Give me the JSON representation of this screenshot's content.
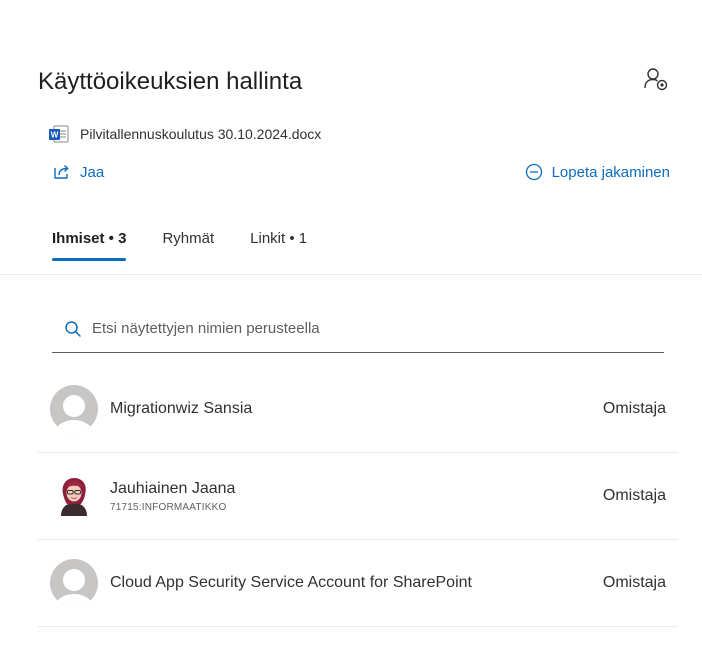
{
  "panel": {
    "title": "Käyttöoikeuksien hallinta",
    "settings_icon": "people-settings-icon"
  },
  "file": {
    "icon": "word-document-icon",
    "name": "Pilvitallennuskoulutus 30.10.2024.docx"
  },
  "actions": {
    "share_label": "Jaa",
    "share_icon": "share-icon",
    "stop_sharing_label": "Lopeta jakaminen",
    "stop_sharing_icon": "minus-circle-icon"
  },
  "tabs": [
    {
      "label": "Ihmiset • 3",
      "active": true
    },
    {
      "label": "Ryhmät",
      "active": false
    },
    {
      "label": "Linkit • 1",
      "active": false
    }
  ],
  "search": {
    "placeholder": "Etsi näytettyjen nimien perusteella",
    "value": ""
  },
  "people": [
    {
      "name": "Migrationwiz Sansia",
      "subtitle": "",
      "role": "Omistaja",
      "avatar": "default-person-avatar"
    },
    {
      "name": "Jauhiainen Jaana",
      "subtitle": "71715:INFORMAATIKKO",
      "role": "Omistaja",
      "avatar": "profile-photo-avatar"
    },
    {
      "name": "Cloud App Security Service Account for SharePoint",
      "subtitle": "",
      "role": "Omistaja",
      "avatar": "default-person-avatar"
    }
  ],
  "colors": {
    "accent": "#0f6cbd",
    "text": "#323130",
    "divider": "#edebe9",
    "avatar_placeholder": "#c8c6c4"
  }
}
